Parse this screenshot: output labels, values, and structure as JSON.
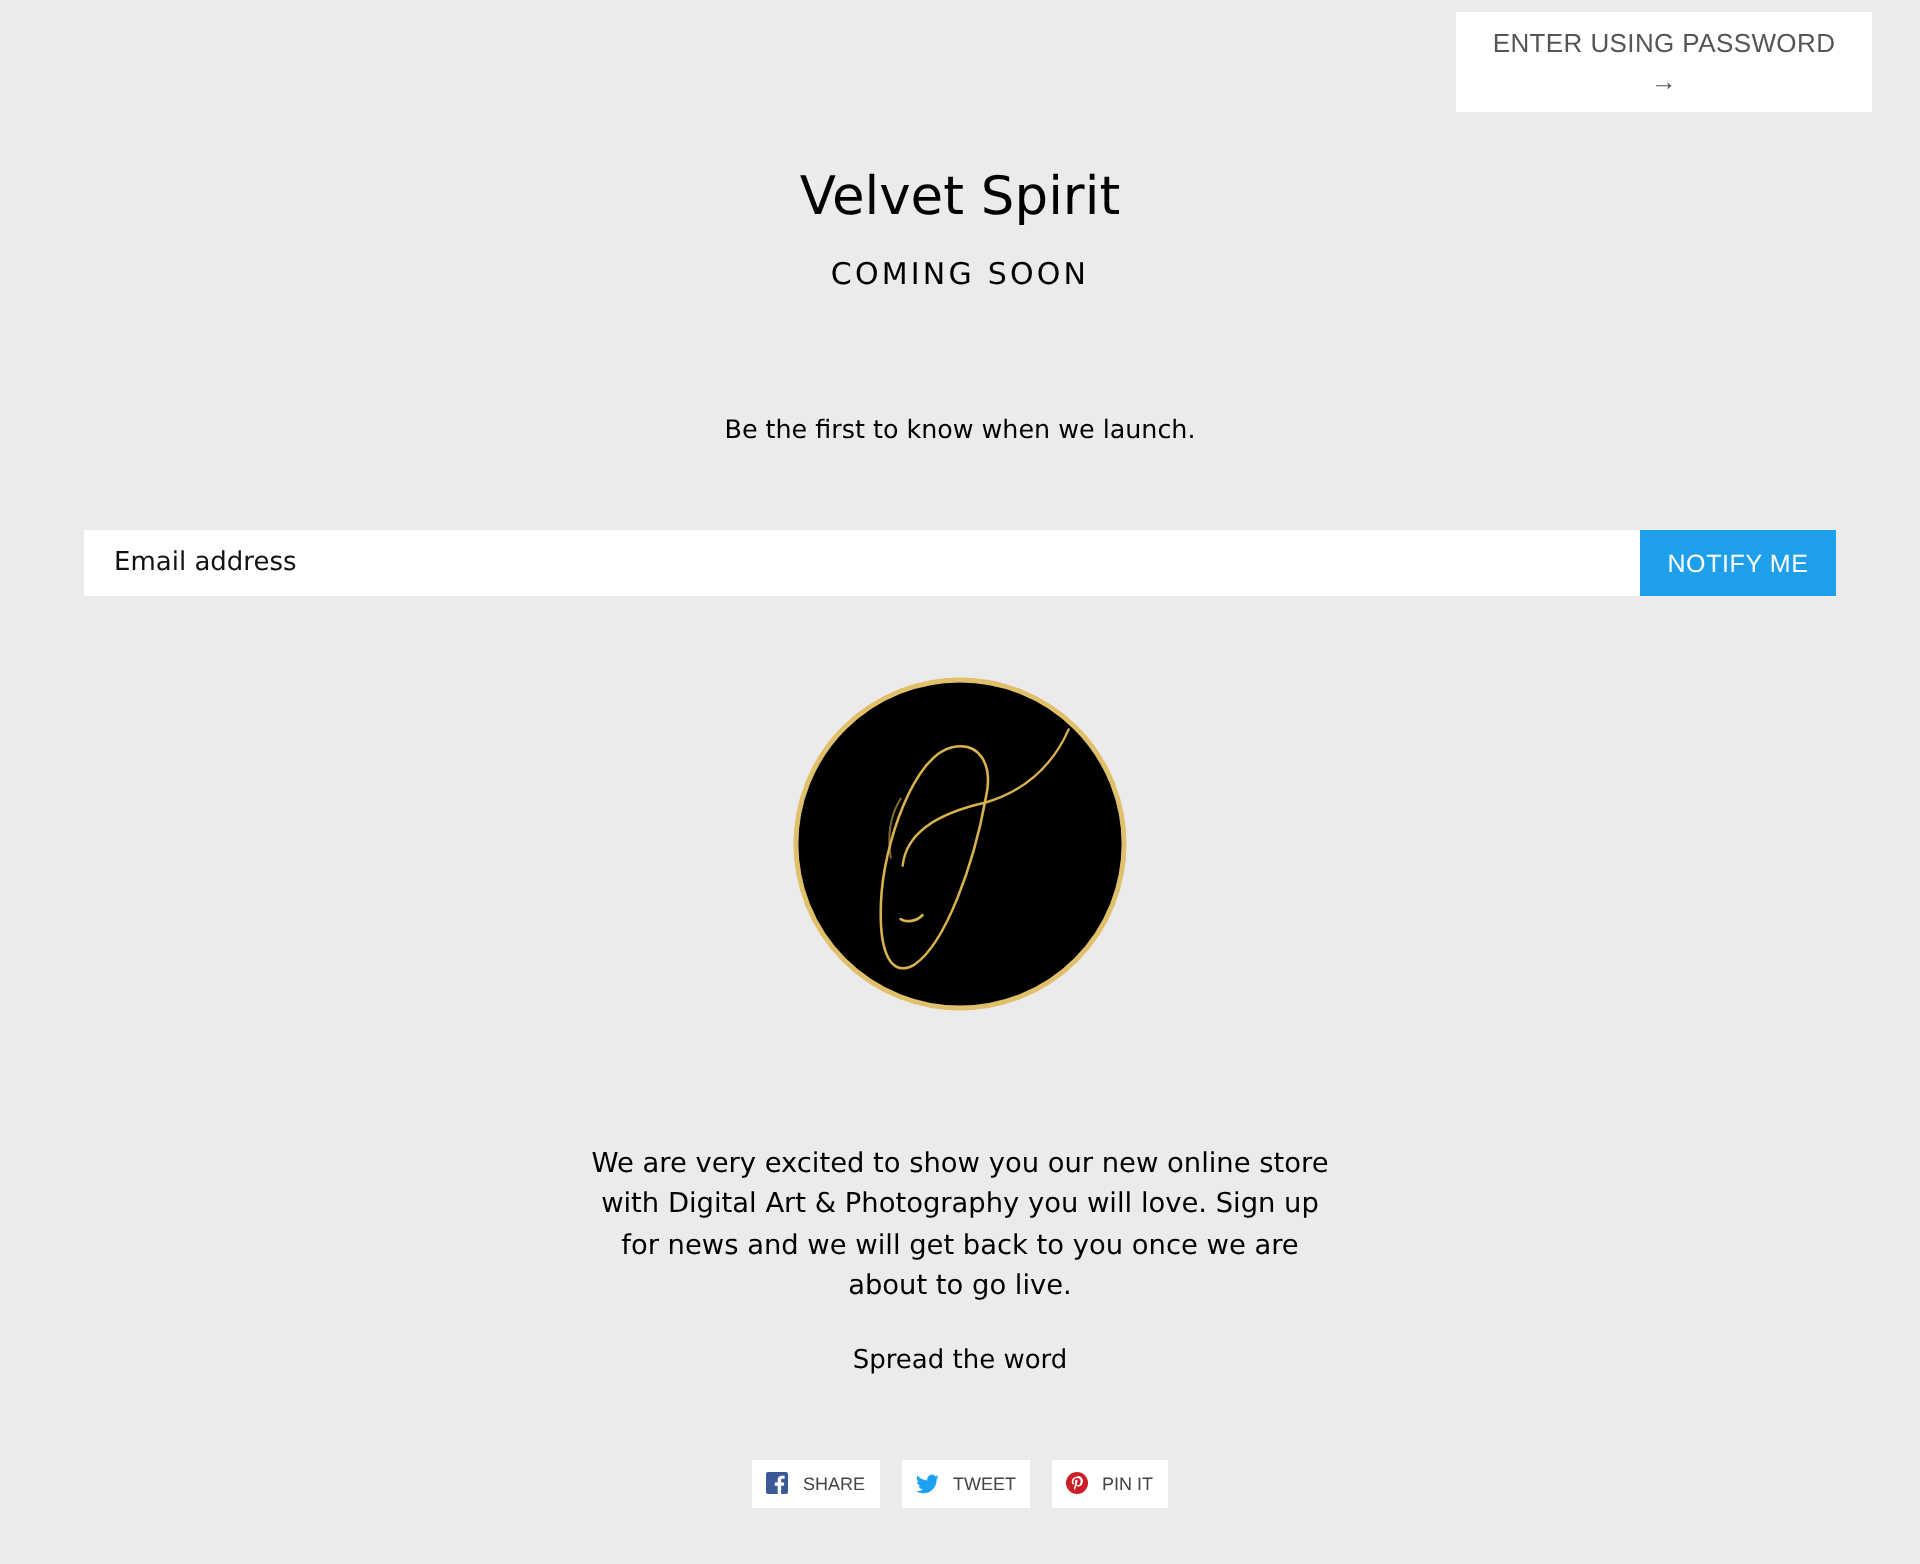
{
  "password_button": {
    "label": "ENTER USING PASSWORD",
    "arrow": "→"
  },
  "header": {
    "title": "Velvet Spirit",
    "subtitle": "COMING SOON"
  },
  "signup": {
    "intro": "Be the first to know when we launch.",
    "email": {
      "placeholder": "Email address"
    },
    "button": "NOTIFY ME"
  },
  "message": "We are very excited to show you our new online store with Digital Art & Photography you will love. Sign up for news and we will get back to you once we are about to go live.",
  "share": {
    "heading": "Spread the word",
    "buttons": [
      {
        "kind": "facebook",
        "label": "SHARE"
      },
      {
        "kind": "twitter",
        "label": "TWEET"
      },
      {
        "kind": "pinterest",
        "label": "PIN IT"
      }
    ]
  }
}
